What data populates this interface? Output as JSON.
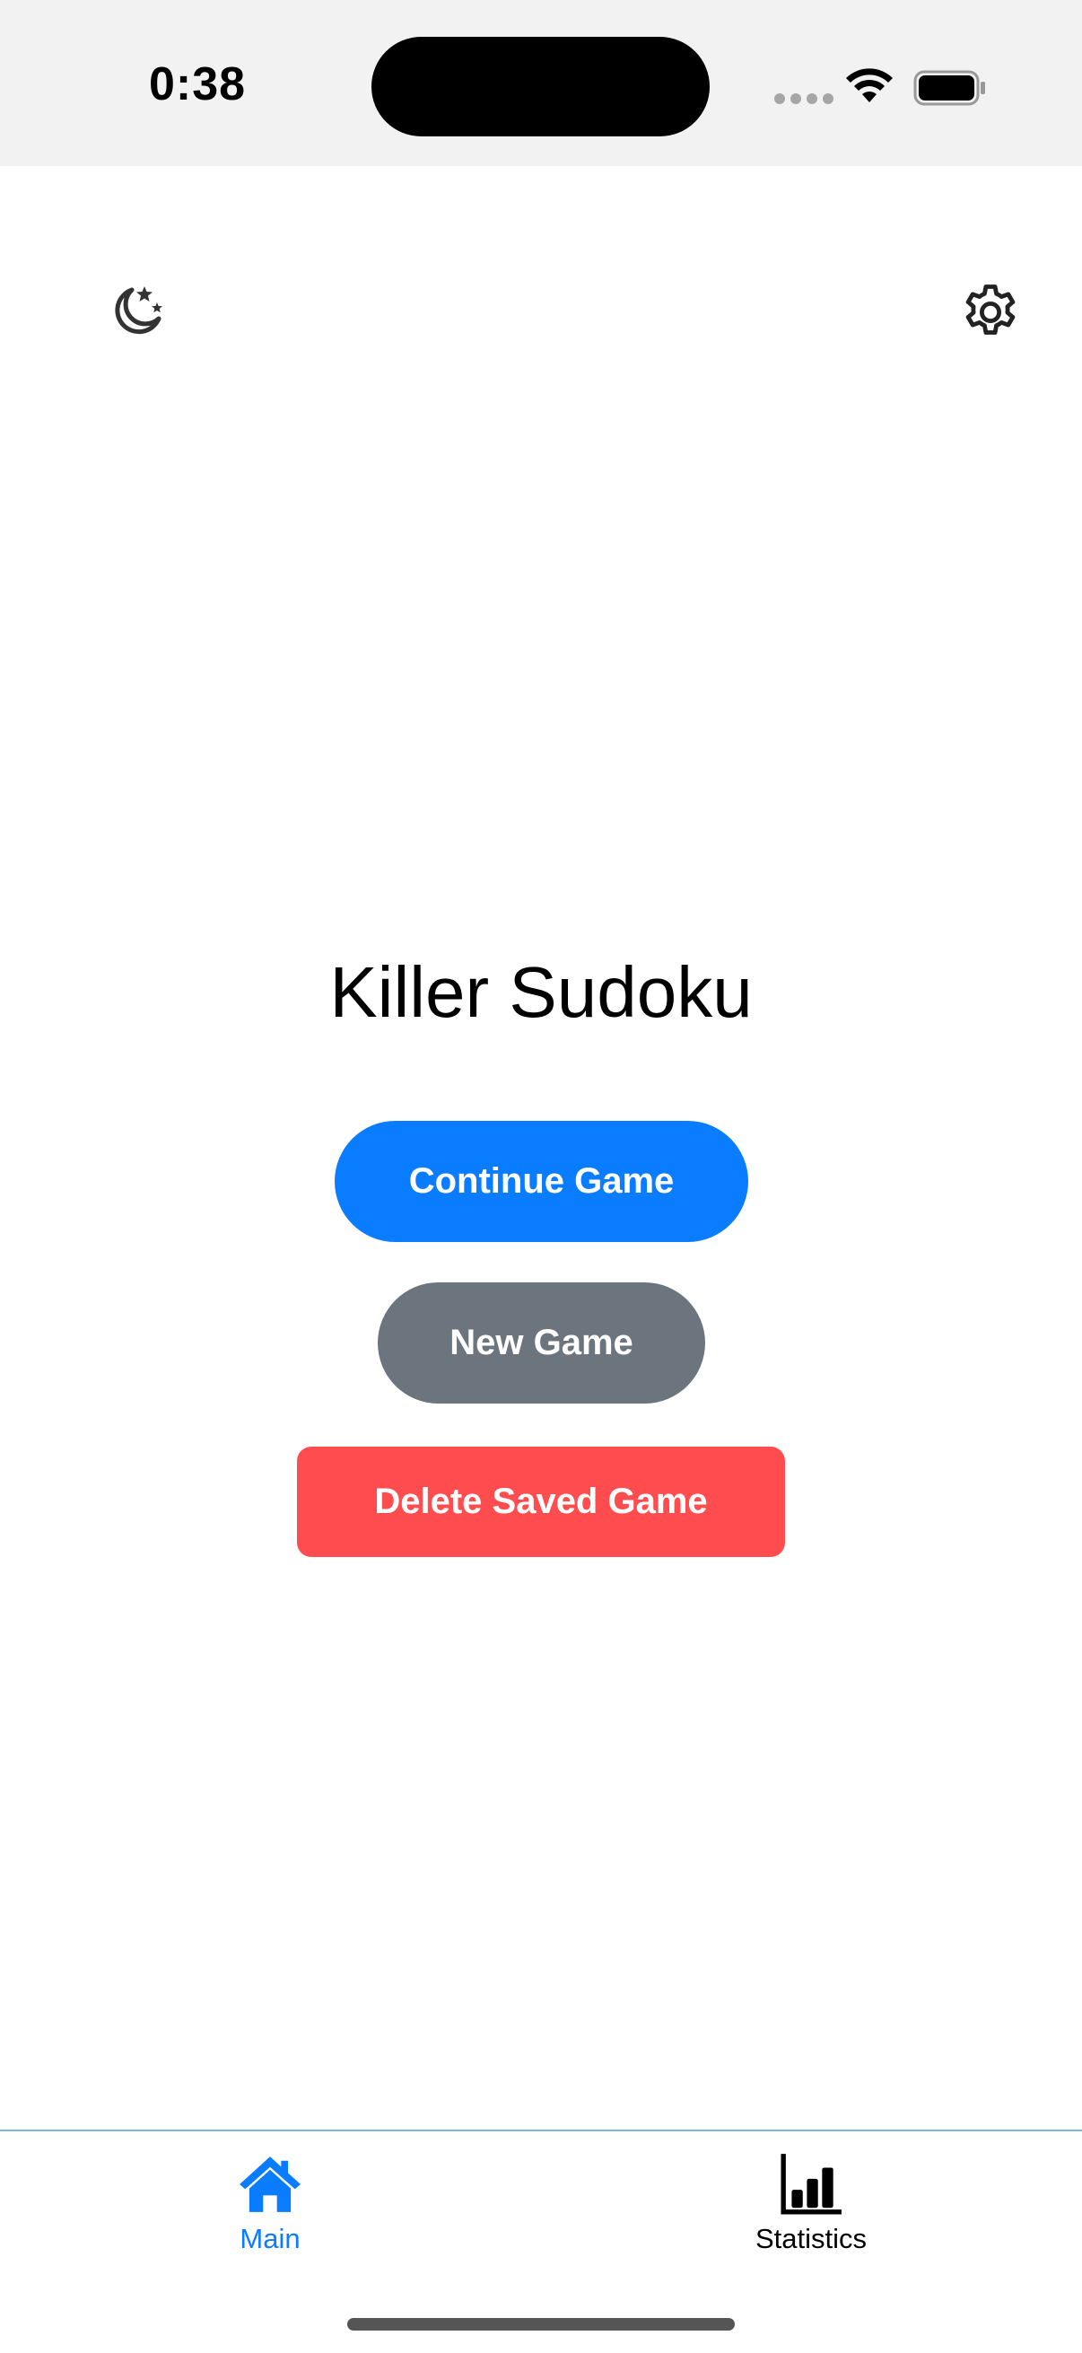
{
  "status_bar": {
    "time": "0:38"
  },
  "header": {
    "night_mode_icon": "moon-stars-icon",
    "settings_icon": "gear-icon"
  },
  "main": {
    "title": "Killer Sudoku",
    "continue_label": "Continue Game",
    "new_label": "New Game",
    "delete_label": "Delete Saved Game"
  },
  "tab_bar": {
    "tabs": [
      {
        "label": "Main",
        "icon": "house-icon",
        "active": true
      },
      {
        "label": "Statistics",
        "icon": "bar-chart-icon",
        "active": false
      }
    ]
  },
  "colors": {
    "accent": "#0a7cff",
    "secondary": "#6c757d",
    "danger": "#ff4d4f"
  }
}
